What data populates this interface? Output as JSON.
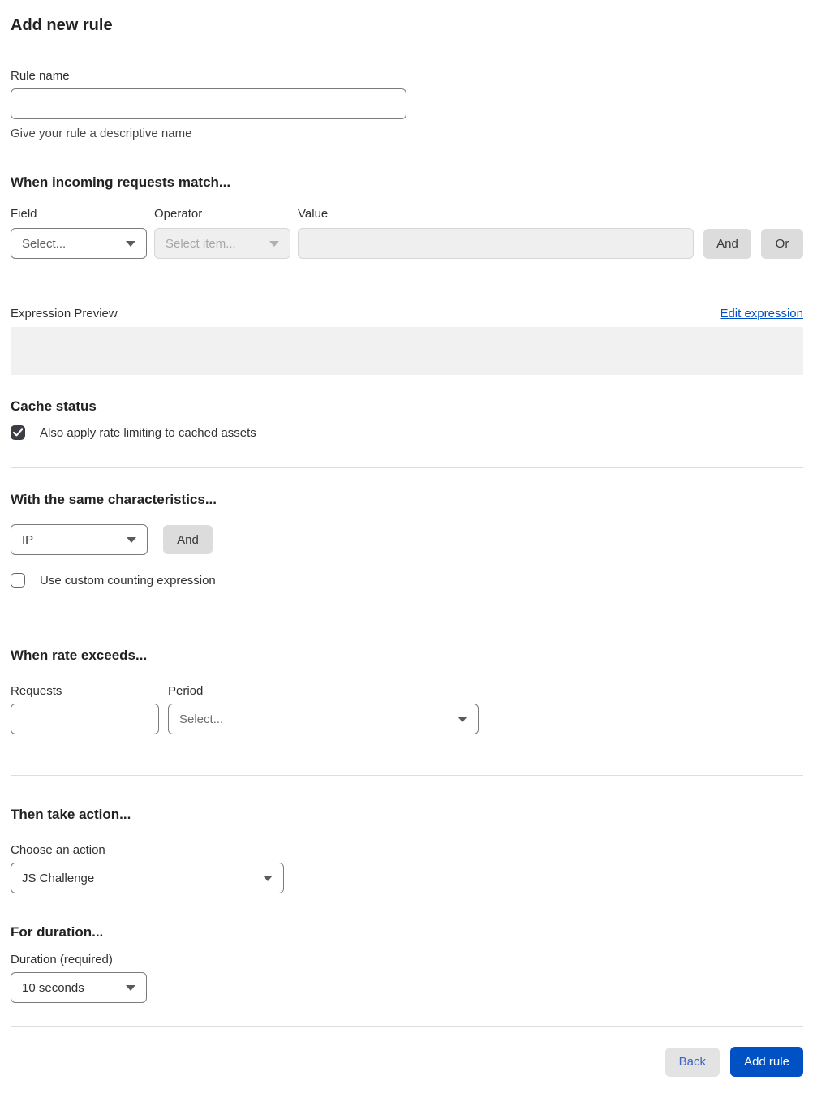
{
  "page": {
    "title": "Add new rule"
  },
  "rule_name": {
    "label": "Rule name",
    "value": "",
    "helper": "Give your rule a descriptive name"
  },
  "match_section": {
    "heading": "When incoming requests match...",
    "field": {
      "label": "Field",
      "selected": "Select..."
    },
    "operator": {
      "label": "Operator",
      "selected": "Select item..."
    },
    "value": {
      "label": "Value",
      "value": ""
    },
    "and_label": "And",
    "or_label": "Or",
    "expression_preview_label": "Expression Preview",
    "edit_expression_label": "Edit expression",
    "expression_value": ""
  },
  "cache_status": {
    "heading": "Cache status",
    "checkbox_label": "Also apply rate limiting to cached assets",
    "checked": true
  },
  "characteristics": {
    "heading": "With the same characteristics...",
    "selected": "IP",
    "and_label": "And",
    "checkbox_label": "Use custom counting expression",
    "checked": false
  },
  "rate": {
    "heading": "When rate exceeds...",
    "requests_label": "Requests",
    "requests_value": "",
    "period_label": "Period",
    "period_selected": "Select..."
  },
  "action": {
    "heading": "Then take action...",
    "choose_label": "Choose an action",
    "selected": "JS Challenge"
  },
  "duration": {
    "heading": "For duration...",
    "label": "Duration (required)",
    "selected": "10 seconds"
  },
  "footer": {
    "back_label": "Back",
    "add_rule_label": "Add rule"
  },
  "colors": {
    "accent_blue": "#0051c3",
    "back_text_blue": "#3e63c6",
    "button_gray": "#dcdcdc",
    "disabled_bg": "#efefef",
    "preview_bg": "#f1f1f1",
    "checkbox_dark": "#3b3e44",
    "divider": "#dedede"
  }
}
